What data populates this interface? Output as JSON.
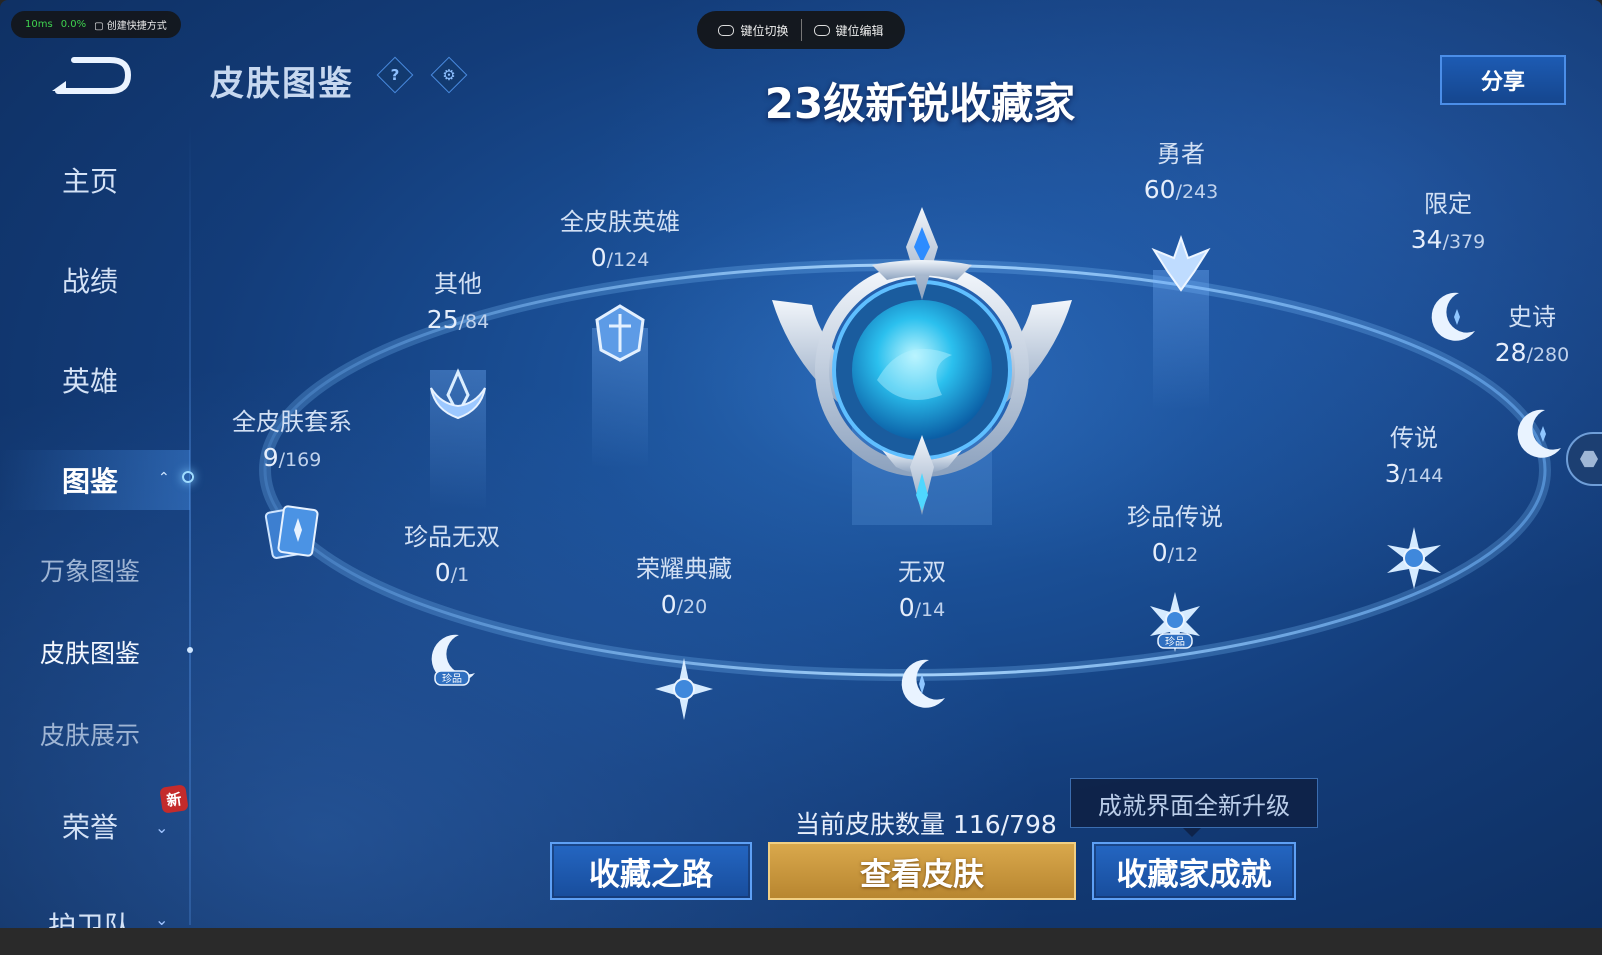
{
  "overlay": {
    "latency": "10ms",
    "loss": "0.0%",
    "shortcut_label": "创建快捷方式",
    "key_switch": "键位切换",
    "key_edit": "键位编辑"
  },
  "header": {
    "page_title": "皮肤图鉴",
    "help_symbol": "?",
    "settings_symbol": "⚙",
    "rank_title": "23级新锐收藏家",
    "share_button": "分享"
  },
  "sidebar": {
    "items": [
      {
        "label": "主页"
      },
      {
        "label": "战绩"
      },
      {
        "label": "英雄"
      },
      {
        "label": "图鉴",
        "active": true
      },
      {
        "label": "万象图鉴"
      },
      {
        "label": "皮肤图鉴",
        "selected": true
      },
      {
        "label": "皮肤展示"
      },
      {
        "label": "荣誉"
      },
      {
        "label": "护卫队"
      }
    ],
    "new_badge": "新"
  },
  "collection_nodes": [
    {
      "label": "全皮肤套系",
      "owned": "9",
      "total": "/169"
    },
    {
      "label": "其他",
      "owned": "25",
      "total": "/84"
    },
    {
      "label": "全皮肤英雄",
      "owned": "0",
      "total": "/124"
    },
    {
      "label": "珍品无双",
      "owned": "0",
      "total": "/1"
    },
    {
      "label": "荣耀典藏",
      "owned": "0",
      "total": "/20"
    },
    {
      "label": "无双",
      "owned": "0",
      "total": "/14"
    },
    {
      "label": "勇者",
      "owned": "60",
      "total": "/243"
    },
    {
      "label": "珍品传说",
      "owned": "0",
      "total": "/12"
    },
    {
      "label": "限定",
      "owned": "34",
      "total": "/379"
    },
    {
      "label": "传说",
      "owned": "3",
      "total": "/144"
    },
    {
      "label": "史诗",
      "owned": "28",
      "total": "/280"
    }
  ],
  "rare_tag": "珍品",
  "footer": {
    "skin_count": "当前皮肤数量 116/798",
    "tip": "成就界面全新升级",
    "btn_road": "收藏之路",
    "btn_view": "查看皮肤",
    "btn_achievement": "收藏家成就"
  },
  "colors": {
    "background": "#133c79",
    "accent_blue": "#1d5bb3",
    "gold": "#d9a84c"
  }
}
